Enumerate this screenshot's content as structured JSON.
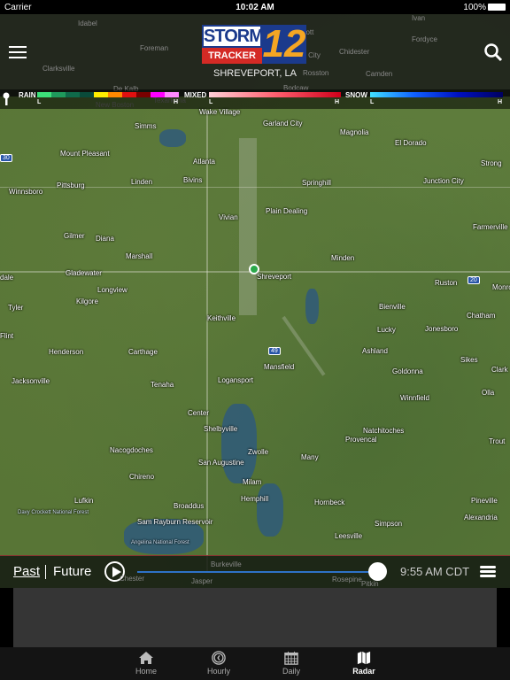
{
  "status": {
    "carrier": "Carrier",
    "time": "10:02 AM",
    "battery": "100%"
  },
  "header": {
    "logo_text": "STORM TRACKER 12",
    "location": "SHREVEPORT, LA",
    "menu_icon": "hamburger-icon",
    "search_icon": "search-icon"
  },
  "legend": {
    "rain": {
      "label": "RAIN",
      "low": "L",
      "high": "H",
      "colors": [
        "#3de07a",
        "#1f9a5c",
        "#0f6a4a",
        "#0a4a3a",
        "#ffee00",
        "#ff8800",
        "#e01010",
        "#7a0000",
        "#ff00ff",
        "#ff88ff"
      ]
    },
    "mixed": {
      "label": "MIXED",
      "low": "L",
      "high": "H",
      "colors": [
        "#ffd0d8",
        "#ff6070",
        "#d0001a"
      ]
    },
    "snow": {
      "label": "SNOW",
      "low": "L",
      "high": "H",
      "colors": [
        "#40e0ff",
        "#1060ff",
        "#0010c0",
        "#000060"
      ]
    }
  },
  "map": {
    "faint_labels": [
      "Idabel",
      "Foreman",
      "Clarksville",
      "Prescott",
      "Bluff City",
      "Chidester",
      "Rosston",
      "Camden",
      "Fordyce",
      "De Kalb",
      "New Boston",
      "Texarkana",
      "Bodcaw",
      "Ivan",
      "Burkeville",
      "Jasper",
      "Chester",
      "Rosepine",
      "Pitkin"
    ],
    "cities": [
      "Wake Village",
      "Simms",
      "Garland City",
      "Magnolia",
      "El Dorado",
      "Mount Pleasant",
      "Atlanta",
      "Strong",
      "Linden",
      "Bivins",
      "Springhill",
      "Junction City",
      "Winnsboro",
      "Pittsburg",
      "Plain Dealing",
      "Vivian",
      "Farmerville",
      "Gilmer",
      "Diana",
      "Minden",
      "Marshall",
      "Gladewater",
      "Shreveport",
      "Ruston",
      "Longview",
      "Kilgore",
      "Tyler",
      "Bienville",
      "Chatham",
      "Keithville",
      "Lucky",
      "Jonesboro",
      "Henderson",
      "Carthage",
      "Ashland",
      "Sikes",
      "Mansfield",
      "Goldonna",
      "Logansport",
      "Tenaha",
      "Jacksonville",
      "Olla",
      "Winnfield",
      "Center",
      "Natchitoches",
      "Shelbyville",
      "Provencal",
      "Trout",
      "Nacogdoches",
      "Zwolle",
      "Many",
      "San Augustine",
      "Chireno",
      "Milam",
      "Hemphill",
      "Hornbeck",
      "Pineville",
      "Lufkin",
      "Broaddus",
      "Simpson",
      "Alexandria",
      "Sam Rayburn Reservoir",
      "Leesville",
      "Monroe",
      "Clark",
      "dale",
      "Flint",
      "Davy Crockett National Forest",
      "Angelina National Forest"
    ],
    "shields": [
      "30",
      "20",
      "49"
    ]
  },
  "timeline": {
    "past": "Past",
    "future": "Future",
    "time": "9:55 AM CDT",
    "progress": 1.0,
    "accent": "#2e72c7"
  },
  "tabs": [
    {
      "label": "Home",
      "icon": "home-icon"
    },
    {
      "label": "Hourly",
      "icon": "clock-icon"
    },
    {
      "label": "Daily",
      "icon": "calendar-icon"
    },
    {
      "label": "Radar",
      "icon": "map-icon",
      "active": true
    }
  ]
}
